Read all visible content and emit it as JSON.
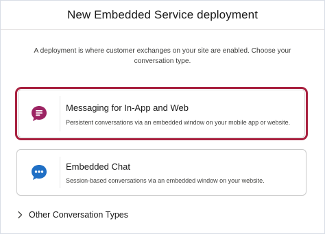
{
  "header": {
    "title": "New Embedded Service deployment"
  },
  "intro": {
    "text": "A deployment is where customer exchanges on your site are enabled. Choose your conversation type."
  },
  "options": [
    {
      "title": "Messaging for In-App and Web",
      "description": "Persistent conversations via an embedded window on your mobile app or website.",
      "icon": "messaging-icon",
      "icon_color": "#9c2463",
      "selected": true
    },
    {
      "title": "Embedded Chat",
      "description": "Session-based conversations via an embedded window on your website.",
      "icon": "chat-icon",
      "icon_color": "#1f6fc5",
      "selected": false
    }
  ],
  "other": {
    "label": "Other Conversation Types",
    "icon": "chevron-right-icon"
  },
  "colors": {
    "selected_border": "#a8203f",
    "card_border": "#c9c9c9"
  }
}
